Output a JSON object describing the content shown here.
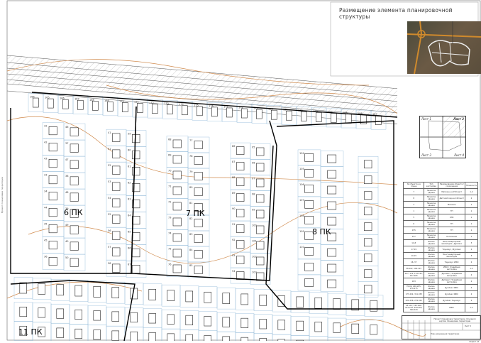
{
  "header": {
    "caption": "Размещение элемента планировочной структуры"
  },
  "key_plan": {
    "cells": [
      "Лист 1",
      "Лист 2",
      "Лист 3",
      "Лист 4"
    ],
    "active": "Лист 2"
  },
  "zones": [
    "6 ПК",
    "7 ПК",
    "8 ПК",
    "11 ПК"
  ],
  "lot_numbers": [
    "164",
    "165",
    "166",
    "167",
    "168",
    "169",
    "170",
    "171",
    "172",
    "173",
    "174",
    "175",
    "176",
    "177",
    "178",
    "179",
    "180",
    "181",
    "182",
    "183",
    "184",
    "185",
    "186",
    "187",
    "32",
    "42",
    "43",
    "33",
    "34",
    "44",
    "35",
    "45",
    "36",
    "46",
    "37",
    "47",
    "38",
    "48",
    "39",
    "49",
    "40",
    "50",
    "41",
    "51",
    "52",
    "53",
    "54",
    "55",
    "56",
    "57",
    "58",
    "59",
    "60",
    "61",
    "62",
    "63",
    "64",
    "65",
    "66",
    "67",
    "68",
    "69",
    "70",
    "71",
    "72",
    "73",
    "74",
    "75",
    "76",
    "77",
    "78",
    "79",
    "80",
    "81",
    "82",
    "83",
    "84",
    "85",
    "86",
    "87",
    "88",
    "89",
    "90",
    "91",
    "92",
    "93",
    "94",
    "95",
    "96",
    "97",
    "98",
    "99",
    "100",
    "101",
    "102",
    "103",
    "104",
    "105",
    "106",
    "107",
    "108",
    "109",
    "110"
  ],
  "table": {
    "headers": [
      "№ объекта на плане",
      "Тип застройки",
      "Наименование объекта / сооружения",
      "Этажность"
    ],
    "rows": [
      [
        "7",
        "Нежилое здание",
        "Магазин на 150 мест",
        "1-2"
      ],
      [
        "8",
        "Нежилое здание",
        "Детский сад на 140 мест",
        "2"
      ],
      [
        "3",
        "Нежилое здание",
        "Магазин",
        "1"
      ],
      [
        "1",
        "Нежилое здание",
        "ТП",
        "1"
      ],
      [
        "5",
        "Нежилое здание",
        "КНС",
        "1"
      ],
      [
        "6",
        "Нежилое здание",
        "ТП",
        "1"
      ],
      [
        "155",
        "Нежилое здание",
        "ТП",
        "1"
      ],
      [
        "157",
        "Нежилое здание",
        "Котельная",
        "1"
      ],
      [
        "11-8",
        "Жилое здание",
        "Многоквартирный жилой дом / Дуплекс",
        "3"
      ],
      [
        "17-19",
        "Жилое здание",
        "Таунхаус / Дуплекс",
        "2"
      ],
      [
        "10-15",
        "Жилое здание",
        "Многоквартирный жилой дом",
        "3"
      ],
      [
        "16, 37",
        "Жилое здание",
        "Таунхаус ИЖС",
        "2"
      ],
      [
        "58-102, 104-107",
        "Жилое здание",
        "ИЖС / Усадебная застройка",
        "1-2"
      ],
      [
        "107, 112, 113-142, 197-205",
        "Жилое здание",
        "Дуплекс / Усадебная застройка",
        "2"
      ],
      [
        "183",
        "Жилое здание",
        "Дуплекс / Усадебная застройка",
        "2"
      ],
      [
        "70-90, 200-205, 270-275",
        "Жилое здание",
        "Дуплекс ИЖС",
        "2"
      ],
      [
        "177-222, 311-333",
        "Жилое здание",
        "Дуплекс ИЖС",
        "2"
      ],
      [
        "221-236, 279-321",
        "Жилое здание",
        "Дуплекс Таунхаус",
        "2"
      ],
      [
        "22-111, 145-160, 161-222, 259-265, 300-333",
        "Жилое здание",
        "ИЖС",
        "1-2"
      ]
    ]
  },
  "stamp": {
    "title": "Проект планировки территории. Основной чертёж планировки территории",
    "sheet": "Лист 2",
    "bottom": "План межевания территории",
    "format": "Формат А3"
  },
  "side_text": "Проект планировки территории"
}
